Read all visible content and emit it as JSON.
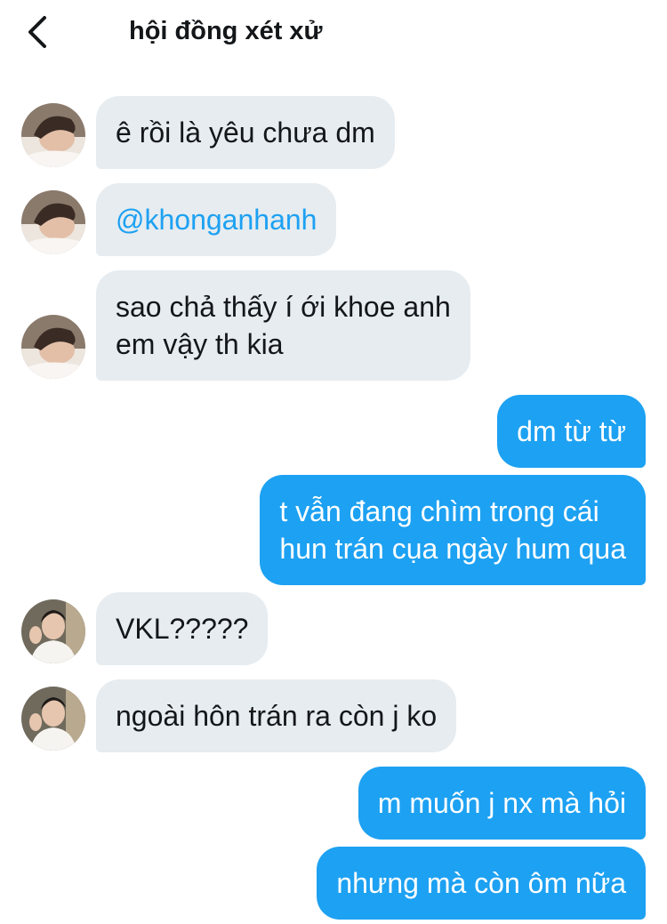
{
  "header": {
    "title": "hội đồng xét xử",
    "back_icon": "chevron-left-icon"
  },
  "colors": {
    "incoming_bubble": "#e6ecf0",
    "outgoing_bubble": "#1da1f2",
    "mention": "#1da1f2"
  },
  "messages": [
    {
      "direction": "incoming",
      "avatar": "user-a",
      "lines": [
        "ê rồi là yêu chưa dm"
      ]
    },
    {
      "direction": "incoming",
      "avatar": "user-a",
      "lines": [
        "@khonganhanh"
      ]
    },
    {
      "direction": "incoming",
      "avatar": "user-a",
      "lines": [
        "sao chả thấy í ới khoe anh",
        "em vậy th kia"
      ]
    },
    {
      "direction": "outgoing",
      "lines": [
        "dm từ từ"
      ]
    },
    {
      "direction": "outgoing",
      "lines": [
        "t vẫn đang chìm trong cái",
        "hun trán cụa ngày hum qua"
      ]
    },
    {
      "direction": "incoming",
      "avatar": "user-b",
      "lines": [
        "VKL?????"
      ]
    },
    {
      "direction": "incoming",
      "avatar": "user-b",
      "lines": [
        "ngoài hôn trán ra còn j ko"
      ]
    },
    {
      "direction": "outgoing",
      "lines": [
        "m muốn j nx mà hỏi"
      ]
    },
    {
      "direction": "outgoing",
      "lines": [
        "nhưng mà còn ôm nữa"
      ]
    }
  ]
}
